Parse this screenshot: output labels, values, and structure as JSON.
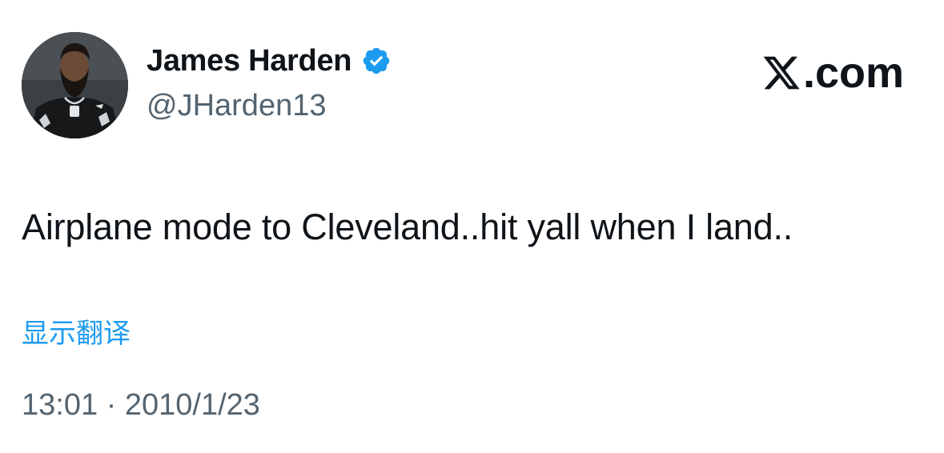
{
  "author": {
    "display_name": "James Harden",
    "handle": "@JHarden13",
    "verified_icon": "verified-badge-icon"
  },
  "brand": {
    "label": ".com",
    "logo_icon": "x-logo-icon"
  },
  "tweet": {
    "text": "Airplane mode to Cleveland..hit yall when I land..",
    "translate_label": "显示翻译",
    "time": "13:01",
    "separator": "·",
    "date": "2010/1/23"
  },
  "colors": {
    "accent": "#1d9bf0",
    "text": "#0f1419",
    "secondary": "#536471"
  }
}
